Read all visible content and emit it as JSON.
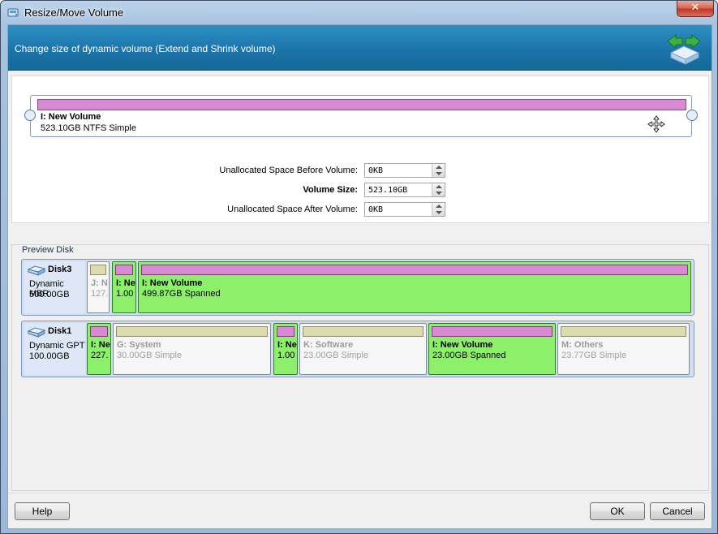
{
  "window": {
    "title": "Resize/Move Volume",
    "close_glyph": "✕"
  },
  "header": {
    "text": "Change size of dynamic volume (Extend and Shrink volume)",
    "icon": "resize-arrows-icon"
  },
  "volume": {
    "name": "I: New Volume",
    "desc": "523.10GB NTFS Simple"
  },
  "fields": {
    "before_label": "Unallocated Space Before Volume:",
    "before_value": "0KB",
    "size_label": "Volume Size:",
    "size_value": "523.10GB",
    "after_label": "Unallocated Space After Volume:",
    "after_value": "0KB"
  },
  "preview": {
    "title": "Preview Disk",
    "disks": [
      {
        "name": "Disk3",
        "type": "Dynamic MBR",
        "size": "500.00GB",
        "partitions": [
          {
            "name": "J: N",
            "desc": "127.",
            "active": false
          },
          {
            "name": "I: Ne",
            "desc": "1.00",
            "active": true
          },
          {
            "name": "I: New Volume",
            "desc": "499.87GB Spanned",
            "active": true
          }
        ]
      },
      {
        "name": "Disk1",
        "type": "Dynamic GPT",
        "size": "100.00GB",
        "partitions": [
          {
            "name": "I: Ne",
            "desc": "227.",
            "active": true
          },
          {
            "name": "G: System",
            "desc": "30.00GB Simple",
            "active": false
          },
          {
            "name": "I: Ne",
            "desc": "1.00",
            "active": true
          },
          {
            "name": "K: Software",
            "desc": "23.00GB Simple",
            "active": false
          },
          {
            "name": "I: New Volume",
            "desc": "23.00GB Spanned",
            "active": true
          },
          {
            "name": "M: Others",
            "desc": "23.77GB Simple",
            "active": false
          }
        ]
      }
    ]
  },
  "buttons": {
    "help": "Help",
    "ok": "OK",
    "cancel": "Cancel"
  },
  "colors": {
    "header": "#1a73a8",
    "volume_bar": "#d88bd2",
    "active_partition": "#8cf06a",
    "inactive_bar": "#dcdcae"
  }
}
